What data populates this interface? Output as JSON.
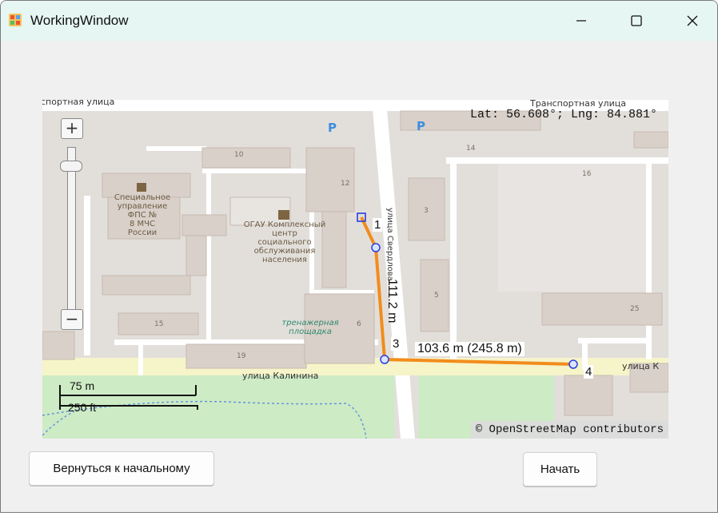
{
  "window": {
    "title": "WorkingWindow",
    "icon": "app-icon"
  },
  "map": {
    "coordinates_readout": "Lat: 56.608°; Lng: 84.881°",
    "attribution": "© OpenStreetMap contributors",
    "zoom_in_label": "+",
    "zoom_out_label": "−",
    "scale_metric": "75 m",
    "scale_imperial": "250 ft",
    "streets": {
      "top_left": "спортная улица",
      "top_right": "Транспортная улица",
      "bottom": "улица Калинина",
      "bottom_right": "улица К",
      "vertical": "улица Свердлова"
    },
    "pois": {
      "fire_service": [
        "Специальное",
        "управление",
        "ФПС №",
        "8 МЧС",
        "России"
      ],
      "social_center": [
        "ОГАУ Комплексный",
        "центр",
        "социального",
        "обслуживания",
        "населения"
      ],
      "training_ground": [
        "тренажерная",
        "площадка"
      ]
    },
    "building_numbers": [
      "10",
      "12",
      "14",
      "16",
      "3",
      "5",
      "25",
      "15",
      "19",
      "6"
    ],
    "parking_label": "P",
    "route": {
      "points": [
        "1",
        "3",
        "4"
      ],
      "segment_1_distance": "111.2 m",
      "segment_2_distance": "103.6 m (245.8 m)",
      "color": "#f28c1c"
    }
  },
  "buttons": {
    "back_label": "Вернуться к начальному",
    "start_label": "Начать"
  }
}
